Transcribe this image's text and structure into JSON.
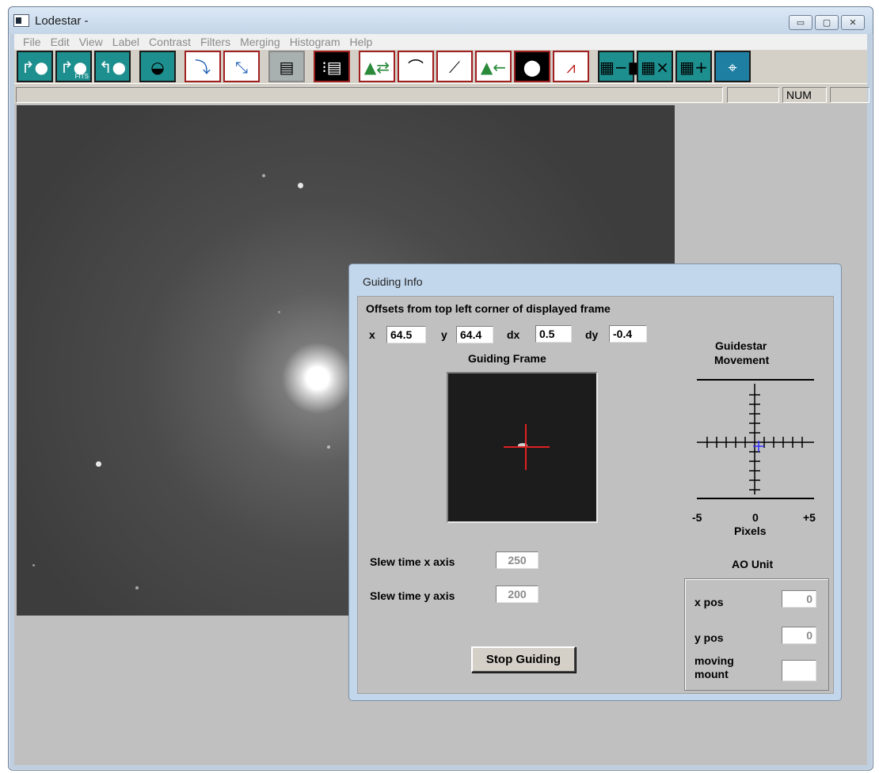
{
  "window": {
    "title": "Lodestar -",
    "buttons": {
      "minimize": "▭",
      "maximize": "▢",
      "close": "✕"
    }
  },
  "menu": [
    "File",
    "Edit",
    "View",
    "Label",
    "Contrast",
    "Filters",
    "Merging",
    "Histogram",
    "Help"
  ],
  "toolbar": {
    "icons": [
      "open-file-icon",
      "open-fits-icon",
      "save-file-icon",
      "filter-icon",
      "import-icon",
      "scale-icon",
      "info-icon",
      "stars-icon",
      "histogram-stretch-icon",
      "curve-icon",
      "linear-stretch-icon",
      "histogram-shift-icon",
      "circle-icon",
      "peak-icon",
      "subtract-icon",
      "multiply-icon",
      "add-icon",
      "telescope-icon"
    ],
    "fits_label": "FITS"
  },
  "statusbar": {
    "num": "NUM"
  },
  "dialog": {
    "title": "Guiding Info",
    "offsets_heading": "Offsets from top left corner of displayed frame",
    "x_label": "x",
    "x_value": "64.5",
    "y_label": "y",
    "y_value": "64.4",
    "dx_label": "dx",
    "dx_value": "0.5",
    "dy_label": "dy",
    "dy_value": "-0.4",
    "guiding_frame_label": "Guiding Frame",
    "movement_label_line1": "Guidestar",
    "movement_label_line2": "Movement",
    "scale_min": "-5",
    "scale_mid": "0",
    "scale_max": "+5",
    "pixels_label": "Pixels",
    "slew_x_label": "Slew time x axis",
    "slew_x_value": "250",
    "slew_y_label": "Slew time y axis",
    "slew_y_value": "200",
    "stop_button": "Stop Guiding",
    "ao_label": "AO Unit",
    "ao_x_label": "x pos",
    "ao_x_value": "0",
    "ao_y_label": "y pos",
    "ao_y_value": "0",
    "moving_label_line1": "moving",
    "moving_label_line2": "mount",
    "moving_value": ""
  },
  "colors": {
    "crosshair": "#e02020",
    "movement_marker": "#3030ff"
  }
}
